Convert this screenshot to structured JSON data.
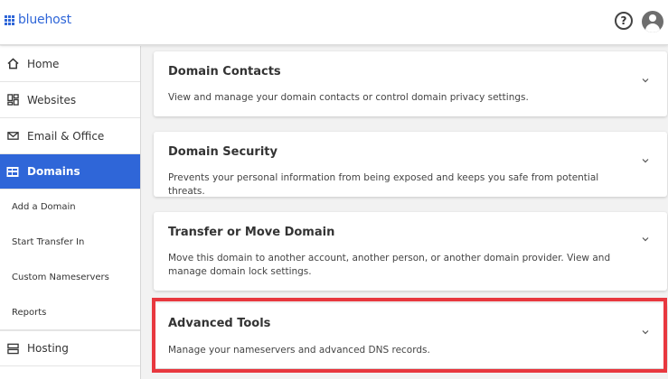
{
  "header": {
    "logo_text": "bluehost",
    "help_icon": "?",
    "brand_color": "#2f66d8"
  },
  "sidebar": {
    "items": [
      {
        "label": "Home",
        "icon": "home-icon"
      },
      {
        "label": "Websites",
        "icon": "dashboard-icon"
      },
      {
        "label": "Email & Office",
        "icon": "mail-icon"
      },
      {
        "label": "Domains",
        "icon": "domains-icon",
        "active": true
      },
      {
        "label": "Hosting",
        "icon": "server-icon"
      }
    ],
    "sub_items": [
      "Add a Domain",
      "Start Transfer In",
      "Custom Nameservers",
      "Reports"
    ]
  },
  "cards": [
    {
      "title": "Domain Contacts",
      "description": "View and manage your domain contacts or control domain privacy settings."
    },
    {
      "title": "Domain Security",
      "description": "Prevents your personal information from being exposed and keeps you safe from potential threats."
    },
    {
      "title": "Transfer or Move Domain",
      "description": "Move this domain to another account, another person, or another domain provider. View and manage domain lock settings."
    },
    {
      "title": "Advanced Tools",
      "description": "Manage your nameservers and advanced DNS records.",
      "highlighted": true
    }
  ],
  "highlight_color": "#e8383f"
}
